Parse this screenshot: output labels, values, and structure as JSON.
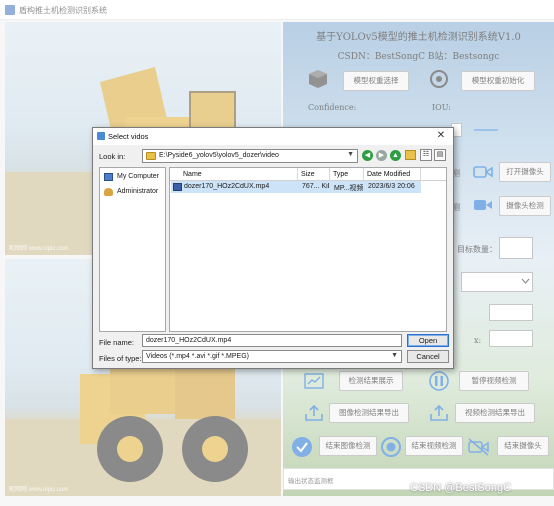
{
  "window": {
    "title": "盾构推土机检测识别系统"
  },
  "left": {
    "watermark_top": "昵图网 www.nipic.com",
    "watermark_bottom": "昵图网 www.nipic.com"
  },
  "right": {
    "title": "基于YOLOv5模型的推土机检测识别系统V1.0",
    "subtitle": "CSDN：BestSongC   B站：Bestsongc",
    "buttons": {
      "model_select": "模型权重选择",
      "model_init": "模型权重初始化",
      "open_camera": "打开摄像头",
      "camera_detect": "摄像头检测",
      "show_results": "检测结果展示",
      "pause_video": "暂停视频检测",
      "export_image": "图像检测结果导出",
      "export_video": "视频检测结果导出",
      "end_image": "结束图像检测",
      "end_video": "结束视频检测",
      "end_camera": "结束摄像头"
    },
    "labels": {
      "confidence": "Confidence:",
      "iou": "IOU:",
      "target_count": "目标数量：",
      "x_suffix": "x:",
      "partial_left_1": "测",
      "partial_left_2": "测"
    },
    "status_placeholder": "输出状态监测框"
  },
  "dialog": {
    "title": "Select vidos",
    "look_in_label": "Look in:",
    "look_in_value": "E:\\Pyside6_yolov5\\yolov5_dozer\\video",
    "sidebar": [
      {
        "label": "My Computer",
        "icon": "computer-icon"
      },
      {
        "label": "Administrator",
        "icon": "user-icon"
      }
    ],
    "columns": [
      "Name",
      "Size",
      "Type",
      "Date Modified"
    ],
    "files": [
      {
        "name": "dozer170_HOz2CdUX.mp4",
        "size": "767... KiB",
        "type": "MP...视频",
        "date": "2023/6/3 20:06"
      }
    ],
    "file_name_label": "File name:",
    "file_name_value": "dozer170_HOz2CdUX.mp4",
    "file_type_label": "Files of type:",
    "file_type_value": "Videos (*.mp4 *.avi *.gif *.MPEG)",
    "open_label": "Open",
    "cancel_label": "Cancel"
  },
  "footer_watermark": "CSDN @BestSongC"
}
